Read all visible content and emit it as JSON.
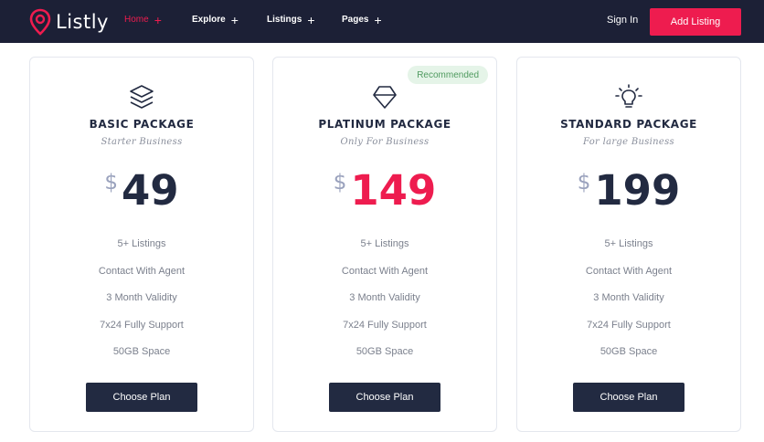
{
  "brand": {
    "name": "Listly",
    "icon": "map-pin-icon",
    "accent": "#ee1c4f",
    "nav_bg": "#1c2036"
  },
  "nav": {
    "items": [
      {
        "label": "Home",
        "active": true
      },
      {
        "label": "Explore",
        "active": false
      },
      {
        "label": "Listings",
        "active": false
      },
      {
        "label": "Pages",
        "active": false
      }
    ],
    "expand_symbol": "+",
    "signin_label": "Sign In",
    "add_listing_label": "Add Listing"
  },
  "plans": [
    {
      "icon": "layers-icon",
      "title": "BASIC PACKAGE",
      "subtitle": "Starter Business",
      "currency": "$",
      "price": "49",
      "features": [
        "5+ Listings",
        "Contact With Agent",
        "3 Month Validity",
        "7x24 Fully Support",
        "50GB Space"
      ],
      "button_label": "Choose Plan"
    },
    {
      "icon": "diamond-icon",
      "badge": "Recommended",
      "title": "PLATINUM PACKAGE",
      "subtitle": "Only For Business",
      "currency": "$",
      "price": "149",
      "price_color": "#ee1c4f",
      "features": [
        "5+ Listings",
        "Contact With Agent",
        "3 Month Validity",
        "7x24 Fully Support",
        "50GB Space"
      ],
      "button_label": "Choose Plan"
    },
    {
      "icon": "lightbulb-icon",
      "title": "STANDARD PACKAGE",
      "subtitle": "For large Business",
      "currency": "$",
      "price": "199",
      "features": [
        "5+ Listings",
        "Contact With Agent",
        "3 Month Validity",
        "7x24 Fully Support",
        "50GB Space"
      ],
      "button_label": "Choose Plan"
    }
  ]
}
